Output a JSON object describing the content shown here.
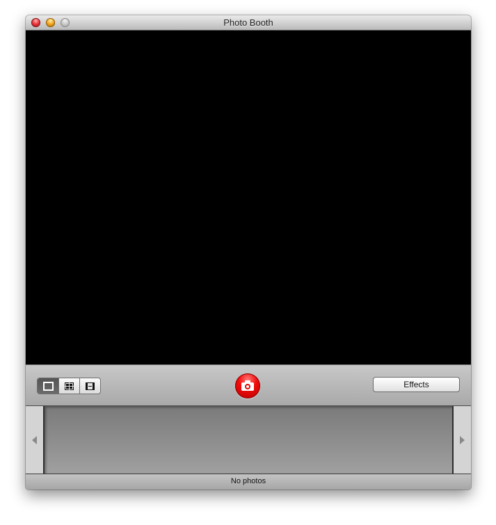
{
  "window": {
    "title": "Photo Booth",
    "traffic_lights": [
      {
        "name": "close",
        "color": "#e8323a"
      },
      {
        "name": "minimize",
        "color": "#f1a51c"
      },
      {
        "name": "zoom",
        "color": "#c4c4c4",
        "state": "disabled"
      }
    ]
  },
  "toolbar": {
    "modes": [
      {
        "name": "single-photo",
        "icon": "single-frame-icon",
        "selected": true
      },
      {
        "name": "four-up",
        "icon": "grid-icon",
        "selected": false
      },
      {
        "name": "movie-clip",
        "icon": "film-icon",
        "selected": false
      }
    ],
    "shutter": {
      "icon": "camera-icon",
      "color": "#f20c0c"
    },
    "effects_label": "Effects"
  },
  "filmstrip": {
    "prev_icon": "chevron-left-icon",
    "next_icon": "chevron-right-icon"
  },
  "status": {
    "text": "No photos"
  }
}
